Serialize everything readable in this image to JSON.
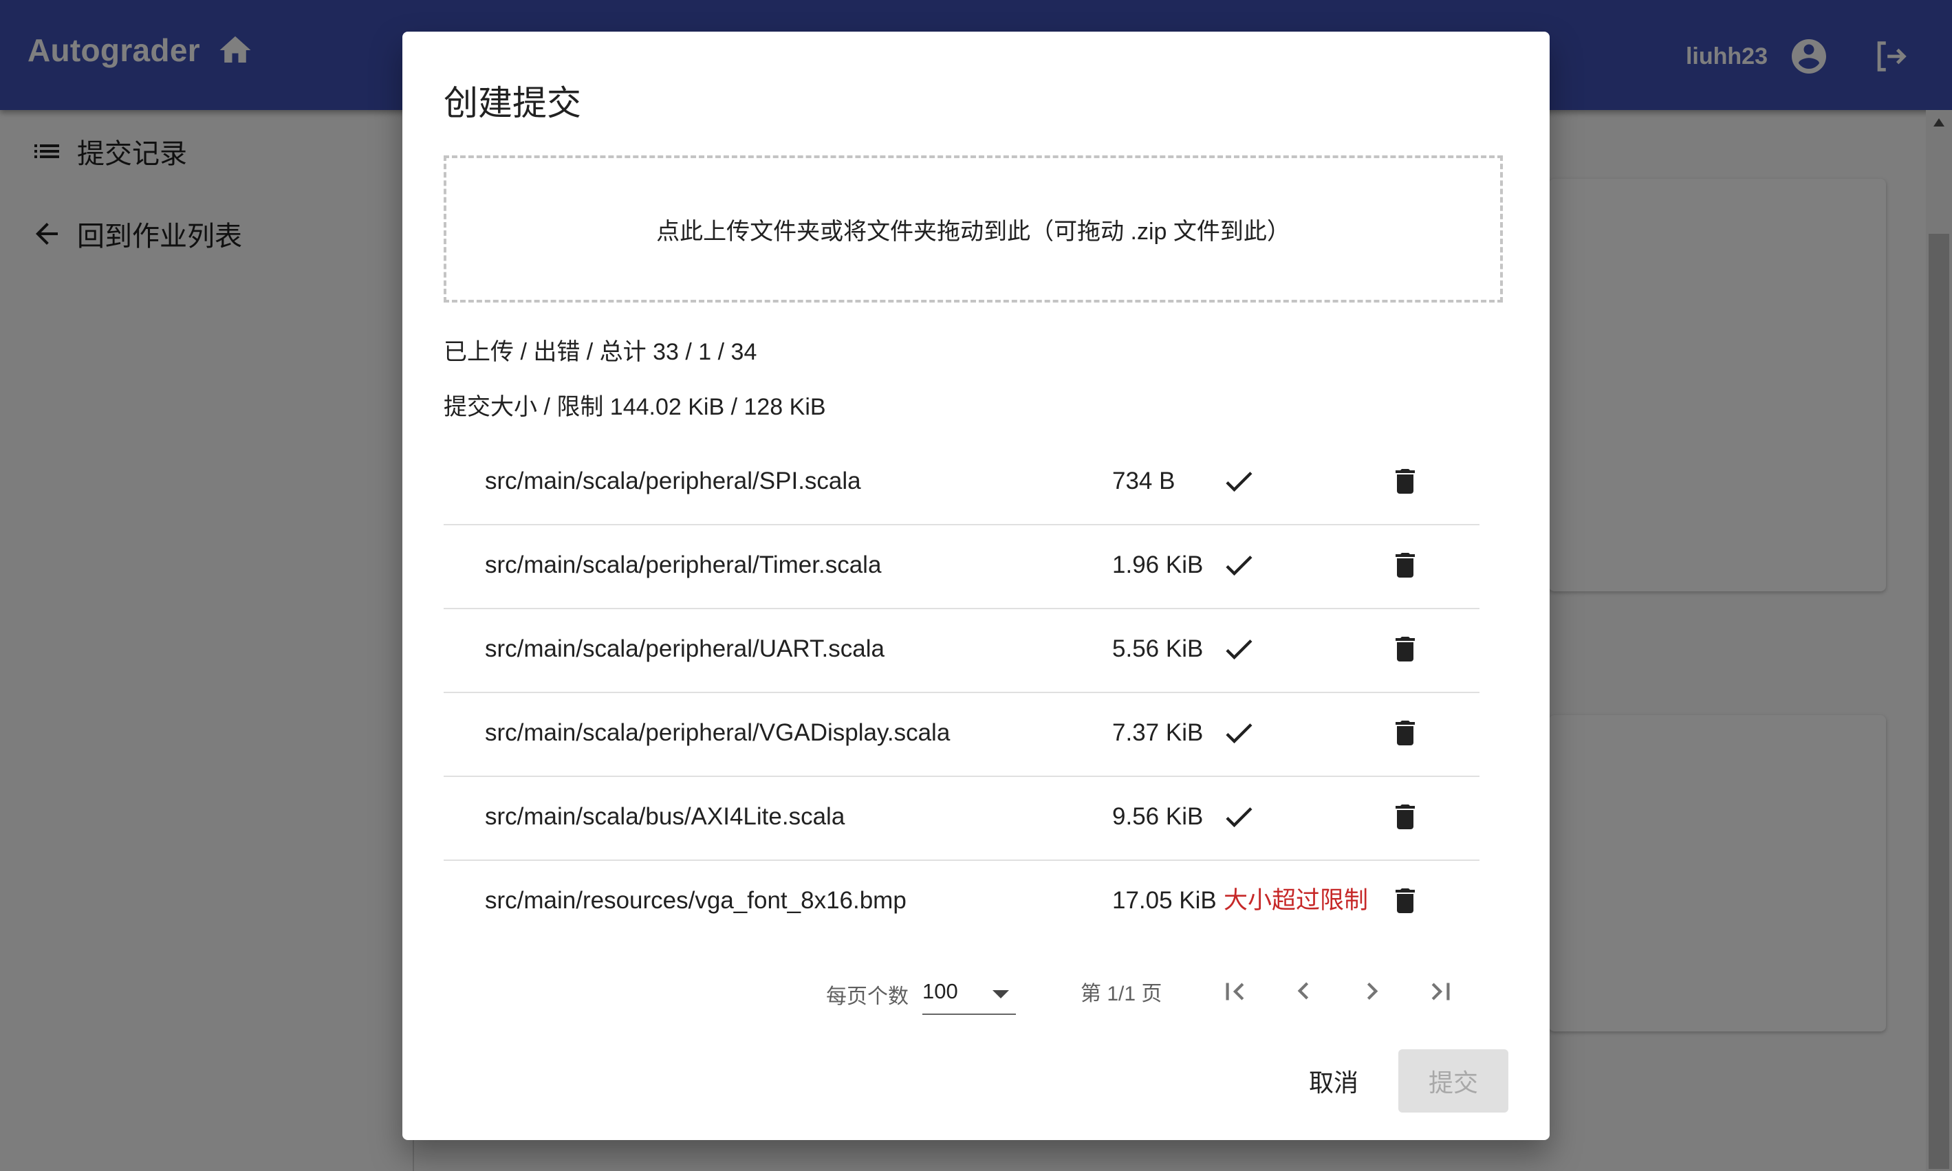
{
  "app": {
    "title": "Autograder",
    "username": "liuhh23",
    "icons": {
      "home": "home-icon",
      "account": "account-circle-icon",
      "logout": "logout-icon"
    },
    "accent_color": "#3f51b5"
  },
  "sidebar": {
    "items": [
      {
        "label": "提交记录",
        "icon": "list-icon"
      },
      {
        "label": "回到作业列表",
        "icon": "arrow-back-icon"
      }
    ]
  },
  "dialog": {
    "title": "创建提交",
    "dropzone_text": "点此上传文件夹或将文件夹拖动到此（可拖动 .zip 文件到此）",
    "upload_stats": "已上传 / 出错 / 总计 33 / 1 / 34",
    "size_stats": "提交大小 / 限制 144.02 KiB / 128 KiB",
    "files": [
      {
        "name": "src/main/scala/peripheral/SPI.scala",
        "size": "734 B",
        "status": "ok",
        "status_icon": "check-icon"
      },
      {
        "name": "src/main/scala/peripheral/Timer.scala",
        "size": "1.96 KiB",
        "status": "ok",
        "status_icon": "check-icon"
      },
      {
        "name": "src/main/scala/peripheral/UART.scala",
        "size": "5.56 KiB",
        "status": "ok",
        "status_icon": "check-icon"
      },
      {
        "name": "src/main/scala/peripheral/VGADisplay.scala",
        "size": "7.37 KiB",
        "status": "ok",
        "status_icon": "check-icon"
      },
      {
        "name": "src/main/scala/bus/AXI4Lite.scala",
        "size": "9.56 KiB",
        "status": "ok",
        "status_icon": "check-icon"
      },
      {
        "name": "src/main/resources/vga_font_8x16.bmp",
        "size": "17.05 KiB",
        "status": "error",
        "status_text": "大小超过限制"
      }
    ],
    "error_color": "#c62828",
    "pagination": {
      "rows_per_page_label": "每页个数",
      "rows_per_page_value": "100",
      "page_info": "第 1/1 页"
    },
    "actions": {
      "cancel_label": "取消",
      "submit_label": "提交"
    }
  }
}
